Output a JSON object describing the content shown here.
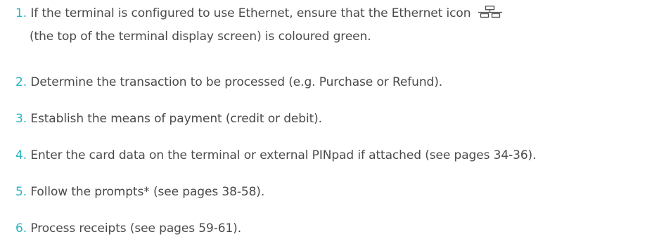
{
  "steps": [
    {
      "number": "1.",
      "text_before_icon": "If the terminal is configured to use Ethernet, ensure that the Ethernet icon",
      "icon": "ethernet-icon",
      "text_continued": "(the top of the terminal display screen) is coloured green."
    },
    {
      "number": "2.",
      "text": "Determine the transaction to be processed (e.g. Purchase or Refund)."
    },
    {
      "number": "3.",
      "text": "Establish the means of payment (credit or debit)."
    },
    {
      "number": "4.",
      "text": "Enter the card data on the terminal or external PINpad if attached (see pages 34-36)."
    },
    {
      "number": "5.",
      "text": "Follow the prompts* (see pages 38-58)."
    },
    {
      "number": "6.",
      "text": "Process receipts (see pages 59-61)."
    }
  ],
  "colors": {
    "number": "#27b5c0",
    "text": "#4a4a4a"
  }
}
